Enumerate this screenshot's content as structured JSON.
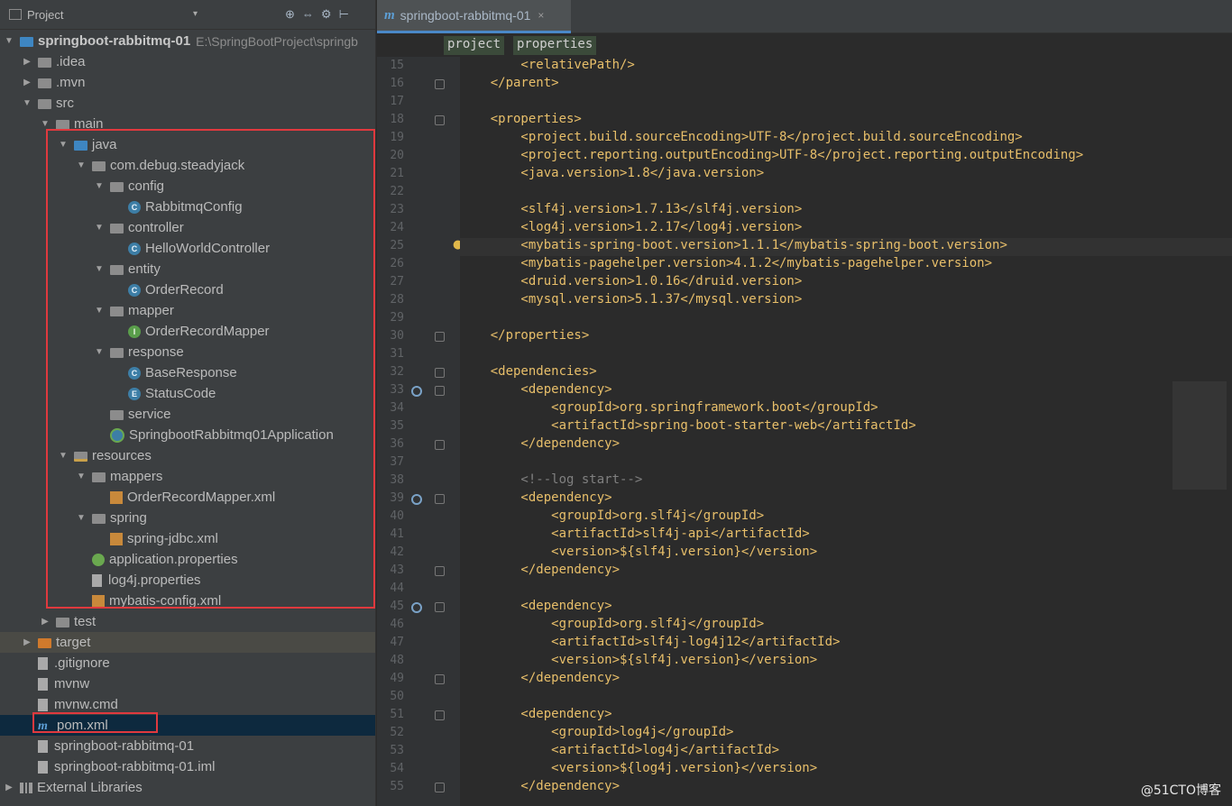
{
  "project_header": {
    "title": "Project",
    "dropdown": "▾",
    "tools": [
      "⊕",
      "⇔",
      "⚙",
      "⊢"
    ]
  },
  "tree": [
    {
      "label": "springboot-rabbitmq-01",
      "hint": "E:\\SpringBootProject\\springb",
      "depth": 0,
      "toggle": "▼",
      "icon": "module-folder",
      "bold": true
    },
    {
      "label": ".idea",
      "depth": 1,
      "toggle": "▶",
      "icon": "folder"
    },
    {
      "label": ".mvn",
      "depth": 1,
      "toggle": "▶",
      "icon": "folder"
    },
    {
      "label": "src",
      "depth": 1,
      "toggle": "▼",
      "icon": "folder"
    },
    {
      "label": "main",
      "depth": 2,
      "toggle": "▼",
      "icon": "folder"
    },
    {
      "label": "java",
      "depth": 3,
      "toggle": "▼",
      "icon": "source-folder"
    },
    {
      "label": "com.debug.steadyjack",
      "depth": 4,
      "toggle": "▼",
      "icon": "package"
    },
    {
      "label": "config",
      "depth": 5,
      "toggle": "▼",
      "icon": "package"
    },
    {
      "label": "RabbitmqConfig",
      "depth": 6,
      "toggle": "",
      "icon": "class"
    },
    {
      "label": "controller",
      "depth": 5,
      "toggle": "▼",
      "icon": "package"
    },
    {
      "label": "HelloWorldController",
      "depth": 6,
      "toggle": "",
      "icon": "class"
    },
    {
      "label": "entity",
      "depth": 5,
      "toggle": "▼",
      "icon": "package"
    },
    {
      "label": "OrderRecord",
      "depth": 6,
      "toggle": "",
      "icon": "class"
    },
    {
      "label": "mapper",
      "depth": 5,
      "toggle": "▼",
      "icon": "package"
    },
    {
      "label": "OrderRecordMapper",
      "depth": 6,
      "toggle": "",
      "icon": "interface"
    },
    {
      "label": "response",
      "depth": 5,
      "toggle": "▼",
      "icon": "package"
    },
    {
      "label": "BaseResponse",
      "depth": 6,
      "toggle": "",
      "icon": "class"
    },
    {
      "label": "StatusCode",
      "depth": 6,
      "toggle": "",
      "icon": "enum"
    },
    {
      "label": "service",
      "depth": 5,
      "toggle": "",
      "icon": "package"
    },
    {
      "label": "SpringbootRabbitmq01Application",
      "depth": 5,
      "toggle": "",
      "icon": "app-class"
    },
    {
      "label": "resources",
      "depth": 3,
      "toggle": "▼",
      "icon": "resources-folder"
    },
    {
      "label": "mappers",
      "depth": 4,
      "toggle": "▼",
      "icon": "package"
    },
    {
      "label": "OrderRecordMapper.xml",
      "depth": 5,
      "toggle": "",
      "icon": "xml-file"
    },
    {
      "label": "spring",
      "depth": 4,
      "toggle": "▼",
      "icon": "package"
    },
    {
      "label": "spring-jdbc.xml",
      "depth": 5,
      "toggle": "",
      "icon": "xml-file"
    },
    {
      "label": "application.properties",
      "depth": 4,
      "toggle": "",
      "icon": "spring-file"
    },
    {
      "label": "log4j.properties",
      "depth": 4,
      "toggle": "",
      "icon": "file"
    },
    {
      "label": "mybatis-config.xml",
      "depth": 4,
      "toggle": "",
      "icon": "xml-file"
    },
    {
      "label": "test",
      "depth": 2,
      "toggle": "▶",
      "icon": "folder"
    },
    {
      "label": "target",
      "depth": 1,
      "toggle": "▶",
      "icon": "excluded-folder"
    },
    {
      "label": ".gitignore",
      "depth": 1,
      "toggle": "",
      "icon": "file"
    },
    {
      "label": "mvnw",
      "depth": 1,
      "toggle": "",
      "icon": "file"
    },
    {
      "label": "mvnw.cmd",
      "depth": 1,
      "toggle": "",
      "icon": "file"
    },
    {
      "label": "pom.xml",
      "depth": 1,
      "toggle": "",
      "icon": "maven-file",
      "selected": true
    },
    {
      "label": "springboot-rabbitmq-01",
      "depth": 1,
      "toggle": "",
      "icon": "file"
    },
    {
      "label": "springboot-rabbitmq-01.iml",
      "depth": 1,
      "toggle": "",
      "icon": "file"
    },
    {
      "label": "External Libraries",
      "depth": 0,
      "toggle": "▶",
      "icon": "library"
    }
  ],
  "editor": {
    "tab_label": "springboot-rabbitmq-01",
    "tab_close": "×",
    "breadcrumbs": [
      "project",
      "properties"
    ],
    "lines": [
      {
        "n": "15",
        "text": "        <relativePath/>"
      },
      {
        "n": "16",
        "text": "    </parent>",
        "fold": true
      },
      {
        "n": "17",
        "text": ""
      },
      {
        "n": "18",
        "text": "    <properties>",
        "fold": true
      },
      {
        "n": "19",
        "text": "        <project.build.sourceEncoding>UTF-8</project.build.sourceEncoding>"
      },
      {
        "n": "20",
        "text": "        <project.reporting.outputEncoding>UTF-8</project.reporting.outputEncoding>"
      },
      {
        "n": "21",
        "text": "        <java.version>1.8</java.version>"
      },
      {
        "n": "22",
        "text": ""
      },
      {
        "n": "23",
        "text": "        <slf4j.version>1.7.13</slf4j.version>"
      },
      {
        "n": "24",
        "text": "        <log4j.version>1.2.17</log4j.version>"
      },
      {
        "n": "25",
        "text": "        <mybatis-spring-boot.version>1.1.1</mybatis-spring-boot.version>",
        "current": true
      },
      {
        "n": "26",
        "text": "        <mybatis-pagehelper.version>4.1.2</mybatis-pagehelper.version>"
      },
      {
        "n": "27",
        "text": "        <druid.version>1.0.16</druid.version>"
      },
      {
        "n": "28",
        "text": "        <mysql.version>5.1.37</mysql.version>"
      },
      {
        "n": "29",
        "text": ""
      },
      {
        "n": "30",
        "text": "    </properties>",
        "fold": true
      },
      {
        "n": "31",
        "text": ""
      },
      {
        "n": "32",
        "text": "    <dependencies>",
        "fold": true
      },
      {
        "n": "33",
        "text": "        <dependency>",
        "fold": true,
        "marker": true
      },
      {
        "n": "34",
        "text": "            <groupId>org.springframework.boot</groupId>"
      },
      {
        "n": "35",
        "text": "            <artifactId>spring-boot-starter-web</artifactId>"
      },
      {
        "n": "36",
        "text": "        </dependency>",
        "fold": true
      },
      {
        "n": "37",
        "text": ""
      },
      {
        "n": "38",
        "text": "        <!--log start-->",
        "comment": true
      },
      {
        "n": "39",
        "text": "        <dependency>",
        "fold": true,
        "marker": true
      },
      {
        "n": "40",
        "text": "            <groupId>org.slf4j</groupId>"
      },
      {
        "n": "41",
        "text": "            <artifactId>slf4j-api</artifactId>"
      },
      {
        "n": "42",
        "text": "            <version>${slf4j.version}</version>"
      },
      {
        "n": "43",
        "text": "        </dependency>",
        "fold": true
      },
      {
        "n": "44",
        "text": ""
      },
      {
        "n": "45",
        "text": "        <dependency>",
        "fold": true,
        "marker": true
      },
      {
        "n": "46",
        "text": "            <groupId>org.slf4j</groupId>"
      },
      {
        "n": "47",
        "text": "            <artifactId>slf4j-log4j12</artifactId>"
      },
      {
        "n": "48",
        "text": "            <version>${slf4j.version}</version>"
      },
      {
        "n": "49",
        "text": "        </dependency>",
        "fold": true
      },
      {
        "n": "50",
        "text": ""
      },
      {
        "n": "51",
        "text": "        <dependency>",
        "fold": true
      },
      {
        "n": "52",
        "text": "            <groupId>log4j</groupId>"
      },
      {
        "n": "53",
        "text": "            <artifactId>log4j</artifactId>"
      },
      {
        "n": "54",
        "text": "            <version>${log4j.version}</version>"
      },
      {
        "n": "55",
        "text": "        </dependency>",
        "fold": true
      }
    ]
  },
  "watermark": "@51CTO博客",
  "colors": {
    "accent": "#4a88c7",
    "highlight_box": "#e0393e",
    "tag": "#e8bf6a",
    "text": "#a9b7c6"
  }
}
